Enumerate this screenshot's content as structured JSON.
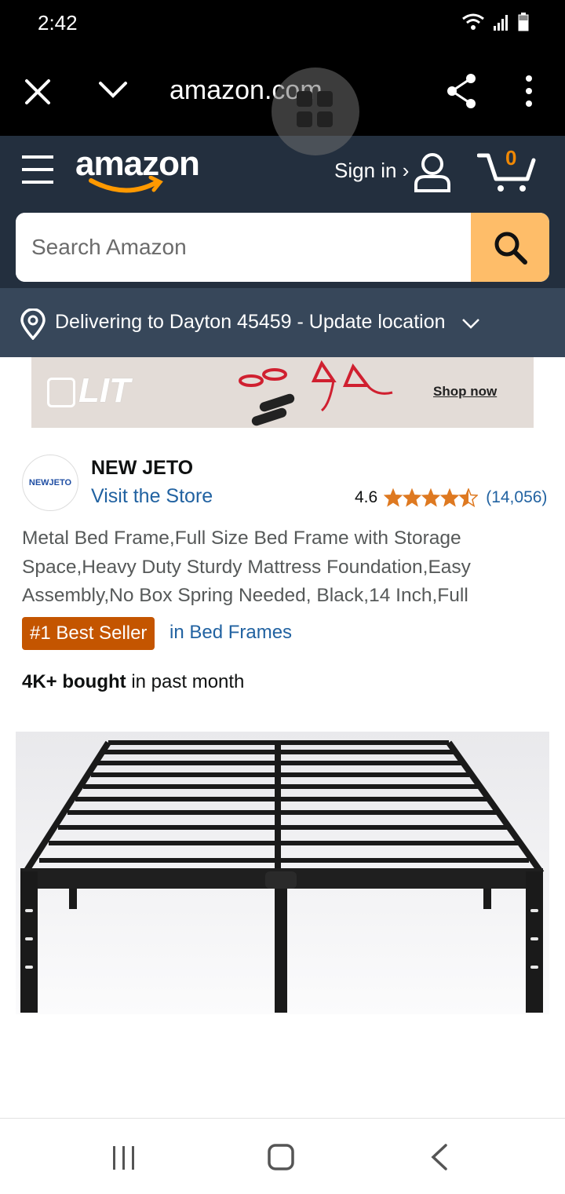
{
  "status_bar": {
    "time": "2:42"
  },
  "tab_toolbar": {
    "url": "amazon.com"
  },
  "header": {
    "logo_text": "amazon",
    "signin_label": "Sign in ›",
    "cart_count": "0",
    "search_placeholder": "Search Amazon",
    "delivery_text": "Delivering to Dayton 45459 - Update location"
  },
  "ad": {
    "brand": "LIT",
    "cta": "Shop now"
  },
  "store": {
    "logo_text": "NEWJETO",
    "brand_name": "NEW JETO",
    "visit_label": "Visit the Store",
    "rating": "4.6",
    "stars": 4.5,
    "review_count": "(14,056)"
  },
  "product": {
    "title": "Metal Bed Frame,Full Size Bed Frame with Storage Space,Heavy Duty Sturdy Mattress Foundation,Easy Assembly,No Box Spring Needed, Black,14 Inch,Full",
    "badge": "#1 Best Seller",
    "badge_category": "in Bed Frames",
    "bought_strong": "4K+ bought",
    "bought_rest": " in past month"
  },
  "colors": {
    "amazon_dark": "#232f3e",
    "amazon_delivery": "#37475a",
    "search_button": "#febd69",
    "badge": "#c45500",
    "link": "#2162a1",
    "star": "#de7921"
  }
}
